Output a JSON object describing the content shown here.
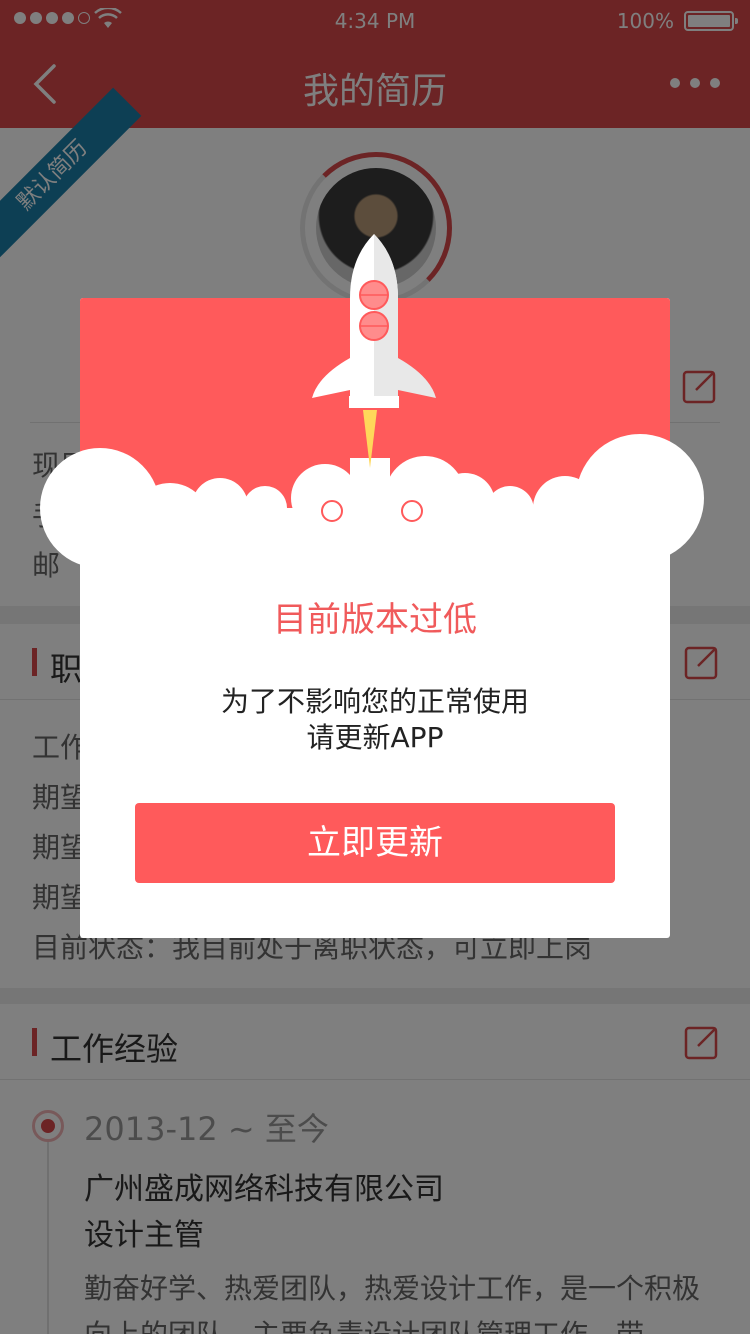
{
  "status_bar": {
    "time": "4:34 PM",
    "battery": "100%",
    "signal_dots_filled": 4,
    "signal_dots_total": 5
  },
  "nav": {
    "title": "我的简历",
    "back_icon": "chevron-left-icon",
    "more_icon": "more-dots-icon"
  },
  "profile": {
    "ribbon": "默认简历",
    "lines": [
      "现居",
      "手",
      "邮"
    ]
  },
  "job_section": {
    "title": "职",
    "lines": [
      "工作",
      "期望",
      "期望",
      "期望",
      "目前状态：我目前处于离职状态，可立即上岗"
    ]
  },
  "experience_section": {
    "title": "工作经验",
    "date": "2013-12 ~ 至今",
    "company": "广州盛成网络科技有限公司",
    "role": "设计主管",
    "desc": "勤奋好学、热爱团队，热爱设计工作，是一个积极向上的团队，主要负责设计团队管理工作，带"
  },
  "dialog": {
    "title": "目前版本过低",
    "message_line1": "为了不影响您的正常使用",
    "message_line2": "请更新APP",
    "button_label": "立即更新"
  },
  "colors": {
    "brand_red": "#d9484a",
    "dialog_red": "#ff5a5b",
    "ribbon_blue": "#1b7fa8"
  }
}
